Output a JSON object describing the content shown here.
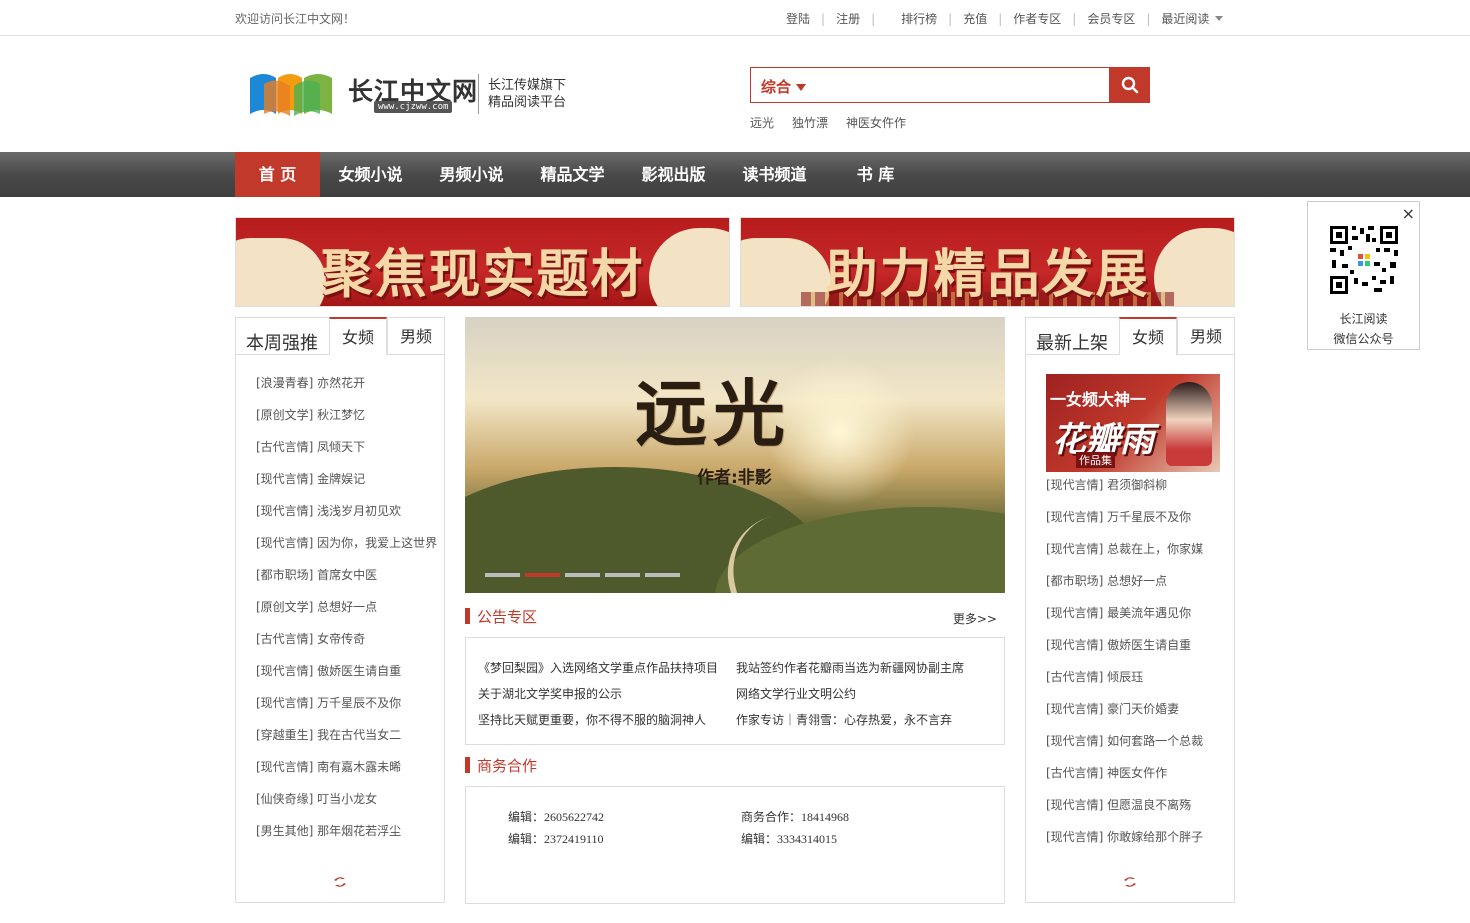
{
  "topbar": {
    "welcome": "欢迎访问长江中文网！",
    "links": [
      "登陆",
      "注册",
      "排行榜",
      "充值",
      "作者专区",
      "会员专区",
      "最近阅读"
    ]
  },
  "header": {
    "brand": "长江中文网",
    "domain": "www.cjzww.com",
    "slogan_1": "长江传媒旗下",
    "slogan_2": "精品阅读平台"
  },
  "search": {
    "category": "综合",
    "placeholder": "",
    "hotwords": [
      "远光",
      "独竹漂",
      "神医女仵作"
    ]
  },
  "nav": {
    "items": [
      "首 页",
      "女频小说",
      "男频小说",
      "精品文学",
      "影视出版",
      "读书频道",
      "书 库"
    ]
  },
  "banners": [
    "聚焦现实题材",
    "助力精品发展"
  ],
  "qr": {
    "close": "×",
    "line1": "长江阅读",
    "line2": "微信公众号"
  },
  "left_panel": {
    "title": "本周强推",
    "tabs": [
      "女频",
      "男频"
    ],
    "items": [
      "[浪漫青春] 亦然花开",
      "[原创文学] 秋江梦忆",
      "[古代言情] 凤倾天下",
      "[现代言情] 金牌娱记",
      "[现代言情] 浅浅岁月初见欢",
      "[现代言情] 因为你，我爱上这世界",
      "[都市职场] 首席女中医",
      "[原创文学] 总想好一点",
      "[古代言情] 女帝传奇",
      "[现代言情] 傲娇医生请自重",
      "[现代言情] 万千星辰不及你",
      "[穿越重生] 我在古代当女二",
      "[现代言情] 南有嘉木露未晞",
      "[仙侠奇缘] 叮当小龙女",
      "[男生其他] 那年烟花若浮尘"
    ]
  },
  "right_panel": {
    "title": "最新上架",
    "tabs": [
      "女频",
      "男频"
    ],
    "cover": {
      "line1": "一女频大神一",
      "line2": "花瓣雨",
      "line3": "作品集"
    },
    "items": [
      "[现代言情] 君须御斜柳",
      "[现代言情] 万千星辰不及你",
      "[现代言情] 总裁在上，你家媒",
      "[都市职场] 总想好一点",
      "[现代言情] 最美流年遇见你",
      "[现代言情] 傲娇医生请自重",
      "[古代言情] 倾辰珏",
      "[现代言情] 豪门天价婚妻",
      "[现代言情] 如何套路一个总裁",
      "[古代言情] 神医女仵作",
      "[现代言情] 但愿温良不离殇",
      "[现代言情] 你敢嫁给那个胖子"
    ]
  },
  "slider": {
    "title": "远光",
    "author": "作者:非影",
    "active_index": 1,
    "count": 5
  },
  "notices": {
    "title": "公告专区",
    "more": "更多>>",
    "items": [
      "《梦回梨园》入选网络文学重点作品扶持项目",
      "我站签约作者花瓣雨当选为新疆网协副主席",
      "关于湖北文学奖申报的公示",
      "网络文学行业文明公约",
      "坚持比天赋更重要，你不得不服的脑洞神人",
      "作家专访｜青翎雪：心存热爱，永不言弃"
    ]
  },
  "business": {
    "title": "商务合作",
    "items": [
      "编辑：2605622742",
      "商务合作：18414968",
      "编辑：2372419110",
      "编辑：3334314015"
    ]
  },
  "colors": {
    "accent": "#c0392b",
    "nav_bg": "#4a4a4a"
  }
}
